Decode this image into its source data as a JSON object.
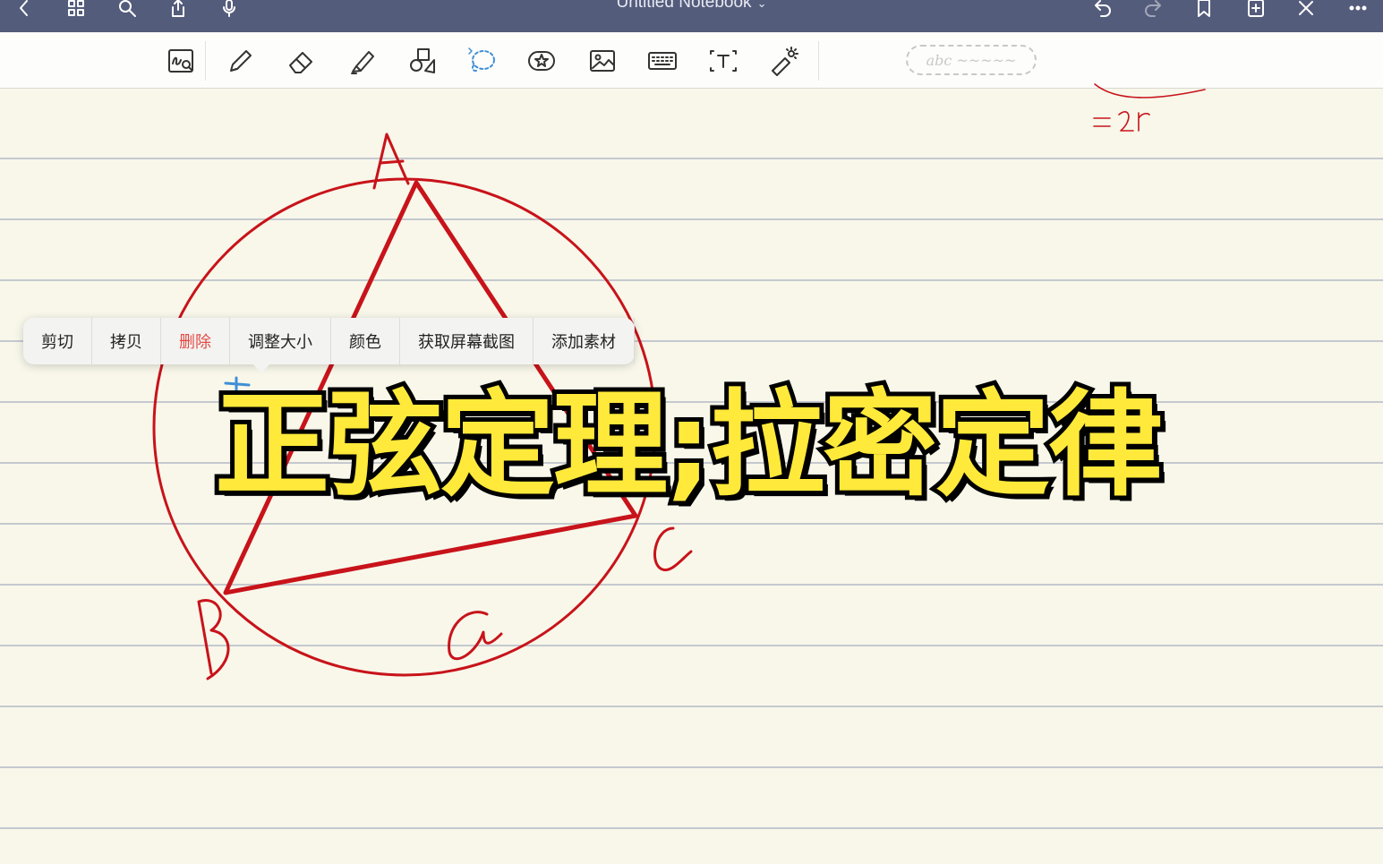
{
  "app": {
    "title": "Untitled Notebook"
  },
  "nav_icons": [
    "back-icon",
    "grid-icon",
    "search-icon",
    "share-icon",
    "microphone-icon",
    "undo-icon",
    "redo-icon",
    "bookmark-icon",
    "add-page-icon",
    "close-icon",
    "more-icon"
  ],
  "toolbar": {
    "tools": [
      "zoom-handwriting-icon",
      "pen-icon",
      "eraser-icon",
      "highlighter-icon",
      "shapes-icon",
      "lasso-icon",
      "sticker-icon",
      "image-icon",
      "keyboard-icon",
      "textbox-icon",
      "laser-pointer-icon"
    ],
    "active_tool": "lasso-icon",
    "pen_preview": "abc ~~~~~"
  },
  "context_menu": {
    "items": [
      {
        "label": "剪切",
        "danger": false
      },
      {
        "label": "拷贝",
        "danger": false
      },
      {
        "label": "删除",
        "danger": true
      },
      {
        "label": "调整大小",
        "danger": false
      },
      {
        "label": "颜色",
        "danger": false
      },
      {
        "label": "获取屏幕截图",
        "danger": false
      },
      {
        "label": "添加素材",
        "danger": false
      }
    ]
  },
  "overlay_title": "正弦定理;拉密定律",
  "colors": {
    "nav_bar": "#545c7c",
    "ink": "#c8131a",
    "overlay_fill": "#ffe93a",
    "danger": "#e24b45",
    "paper": "#f8f7ea"
  }
}
